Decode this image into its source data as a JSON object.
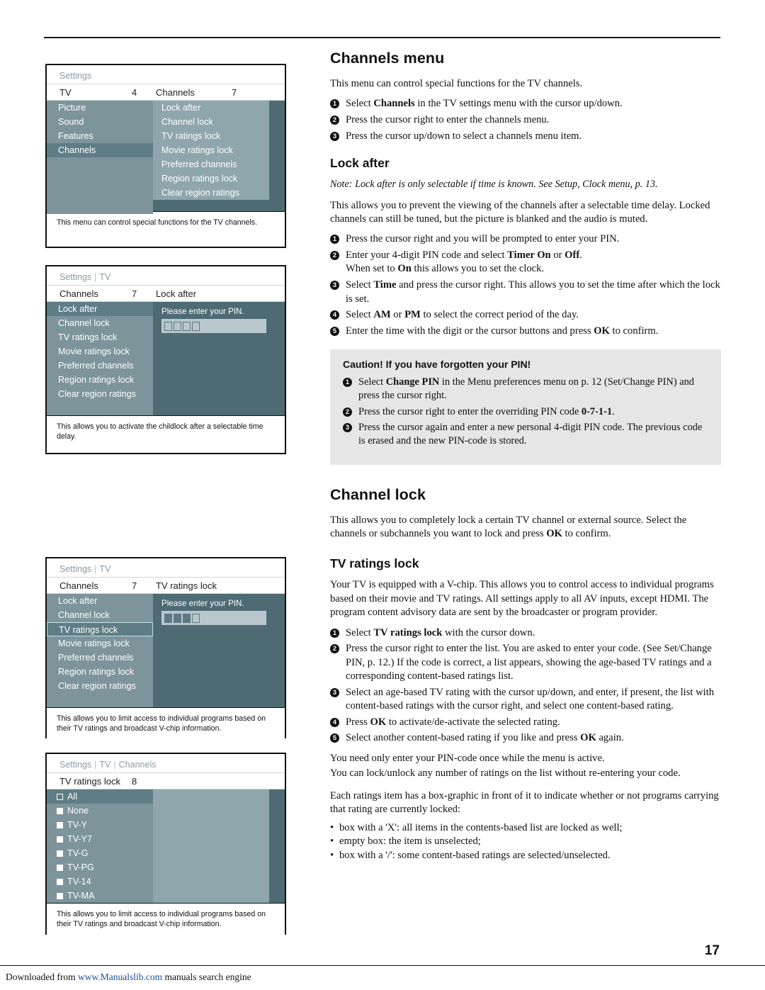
{
  "page_number": "17",
  "footer": {
    "prefix": "Downloaded from ",
    "link": "www.Manualslib.com",
    "suffix": " manuals search engine"
  },
  "right": {
    "channels_menu": {
      "title": "Channels menu",
      "intro": "This menu can control special functions for the TV channels.",
      "steps": [
        "Select <b>Channels</b> in the TV settings menu with the cursor up/down.",
        "Press the cursor right to enter the channels menu.",
        "Press the cursor up/down to select a channels menu item."
      ]
    },
    "lock_after": {
      "title": "Lock after",
      "note": "Note: Lock after is only selectable if time is known. See Setup, Clock menu, p. 13.",
      "intro": "This allows you to prevent the viewing of the channels after a selectable time delay. Locked channels can still be tuned, but the picture is blanked and the audio is muted.",
      "steps": [
        "Press the cursor right and you will be prompted to enter your PIN.",
        "Enter your 4-digit PIN code and select <b>Timer On</b> or <b>Off</b>.<br>When set to <b>On</b> this allows you to set the clock.",
        "Select <b>Time</b> and press the cursor right. This allows you to set the time after which the lock is set.",
        "Select <b>AM</b> or <b>PM</b> to select the correct period of the day.",
        "Enter the time with the digit or the cursor buttons and press <b>OK</b> to confirm."
      ]
    },
    "caution": {
      "title": "Caution! If you have forgotten your PIN!",
      "steps": [
        "Select <b>Change PIN</b> in the Menu preferences menu on p. 12 (Set/Change PIN) and press the cursor right.",
        "Press the cursor right to enter the overriding PIN code <b>0-7-1-1</b>.",
        "Press the cursor again and enter a new personal 4-digit PIN code. The previous code is erased and the new PIN-code is stored."
      ]
    },
    "channel_lock": {
      "title": "Channel lock",
      "body": "This allows you to completely lock a certain TV channel or external source. Select the channels or subchannels you want to lock and press <b>OK</b> to confirm."
    },
    "tv_ratings_lock": {
      "title": "TV ratings lock",
      "intro": "Your TV is equipped with a V-chip. This allows you to control access to individual programs based on their movie and TV ratings. All settings apply to all AV inputs, except HDMI. The program content advisory data are sent by the broadcaster or program provider.",
      "steps": [
        "Select <b>TV ratings lock</b> with the cursor down.",
        "Press the cursor right to enter the list. You are asked to enter your code. (See Set/Change PIN, p. 12.) If the code is correct, a list appears, showing the age-based TV ratings and a corresponding content-based ratings list.",
        "Select an age-based TV rating with the cursor up/down, and enter, if present, the list with content-based ratings with the cursor right, and select one content-based rating.",
        "Press <b>OK</b> to activate/de-activate the selected rating.",
        "Select another content-based rating if you like and press <b>OK</b> again."
      ],
      "after1": "You need only enter your PIN-code once while the menu is active.",
      "after2": "You can lock/unlock any number of ratings on the list without re-entering your code.",
      "after3": "Each ratings item has a box-graphic in front of it to indicate whether or not programs carrying that rating are currently locked:",
      "bullets": [
        "box with a 'X': all items in the contents-based list are locked as well;",
        "empty box: the item is unselected;",
        "box with a '/': some content-based ratings are selected/unselected."
      ]
    }
  },
  "screens": [
    {
      "id": "screen-settings-tv",
      "title": "Settings",
      "title_parts": [],
      "head": {
        "left": "TV",
        "num": "4",
        "right": "Channels",
        "rnum": "7"
      },
      "left_items": [
        "Picture",
        "Sound",
        "Features",
        "Channels"
      ],
      "left_selected_index": 3,
      "right_items": [
        "Lock after",
        "Channel lock",
        "TV ratings lock",
        "Movie ratings lock",
        "Preferred channels",
        "Region ratings lock",
        "Clear region ratings"
      ],
      "caption": "This menu can control special functions for the TV channels."
    },
    {
      "id": "screen-lock-after",
      "title_parts": [
        "Settings",
        "TV"
      ],
      "head": {
        "left": "Channels",
        "num": "7",
        "right": "Lock after",
        "rnum": ""
      },
      "left_items": [
        "Lock after",
        "Channel lock",
        "TV ratings lock",
        "Movie ratings lock",
        "Preferred channels",
        "Region ratings lock",
        "Clear region ratings"
      ],
      "left_selected_index": 0,
      "pin_prompt": "Please enter your PIN.",
      "pin_filled": 0,
      "caption": "This allows you to activate the childlock after a selectable time delay."
    },
    {
      "id": "screen-tv-ratings-lock",
      "title_parts": [
        "Settings",
        "TV"
      ],
      "head": {
        "left": "Channels",
        "num": "7",
        "right": "TV ratings lock",
        "rnum": ""
      },
      "left_items": [
        "Lock after",
        "Channel lock",
        "TV ratings lock",
        "Movie ratings lock",
        "Preferred channels",
        "Region ratings lock",
        "Clear region ratings"
      ],
      "left_selected_index": 2,
      "pin_prompt": "Please enter your PIN.",
      "pin_filled": 3,
      "caption": "This allows you to limit access to individual programs based on their TV ratings and broadcast V-chip information."
    },
    {
      "id": "screen-ratings-list",
      "title_parts": [
        "Settings",
        "TV",
        "Channels"
      ],
      "head": {
        "left": "TV ratings lock",
        "num": "8",
        "right": "",
        "rnum": ""
      },
      "ratings": [
        {
          "label": "All",
          "box": "empty",
          "selected": true
        },
        {
          "label": "None",
          "box": "filled",
          "selected": false
        },
        {
          "label": "TV-Y",
          "box": "filled",
          "selected": false
        },
        {
          "label": "TV-Y7",
          "box": "filled",
          "selected": false
        },
        {
          "label": "TV-G",
          "box": "filled",
          "selected": false
        },
        {
          "label": "TV-PG",
          "box": "filled",
          "selected": false
        },
        {
          "label": "TV-14",
          "box": "filled",
          "selected": false
        },
        {
          "label": "TV-MA",
          "box": "filled",
          "selected": false
        }
      ],
      "caption": "This allows you to limit access to individual programs based on their TV ratings and broadcast V-chip information."
    }
  ]
}
